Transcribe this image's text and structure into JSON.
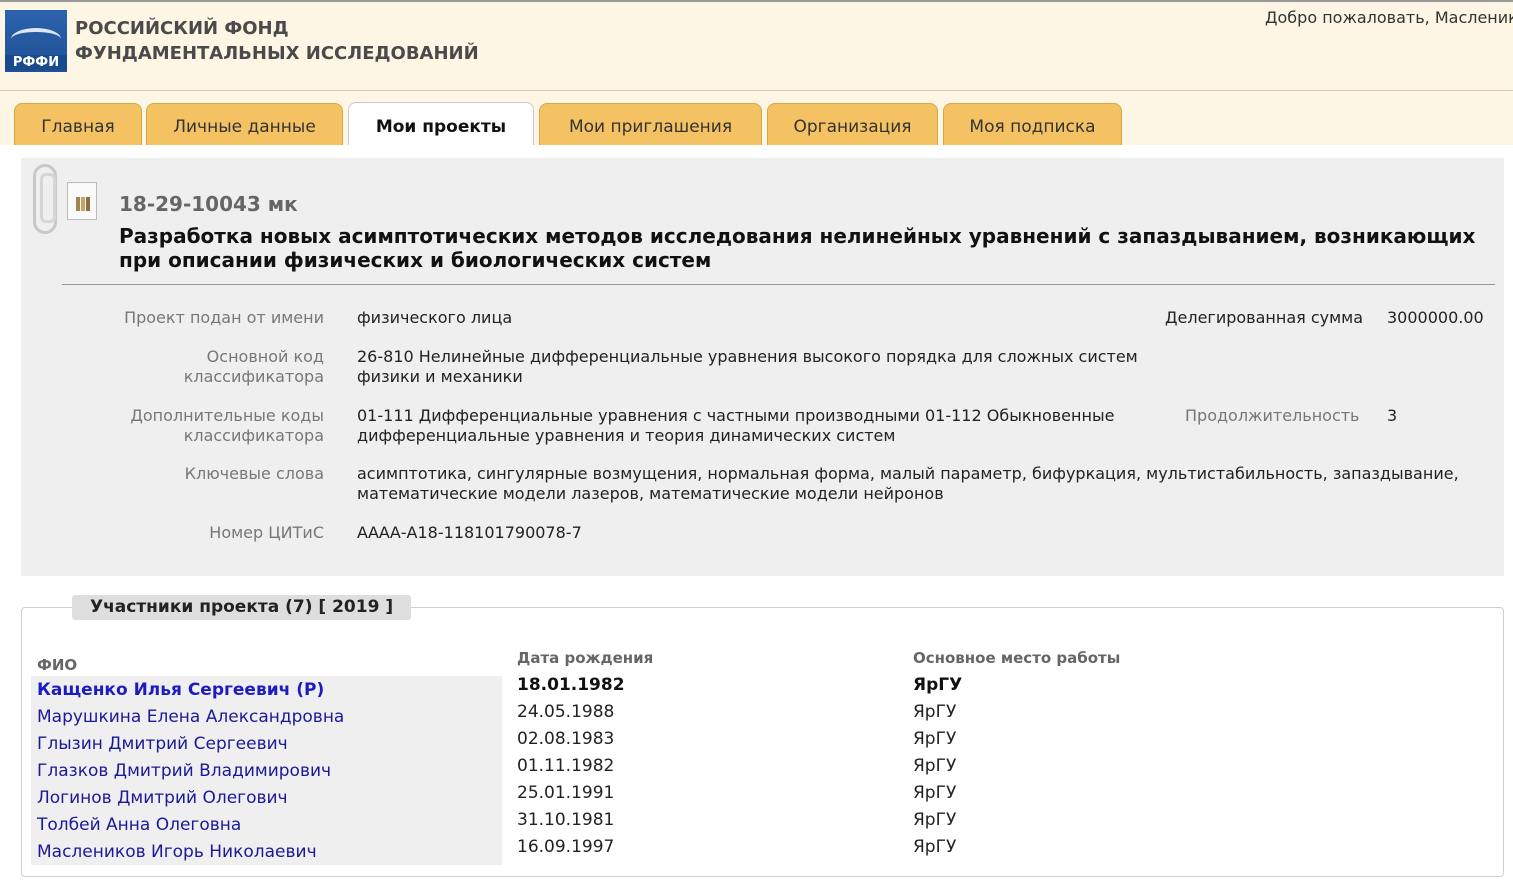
{
  "header": {
    "org_line1": "РОССИЙСКИЙ ФОНД",
    "org_line2": "ФУНДАМЕНТАЛЬНЫХ ИССЛЕДОВАНИЙ",
    "logo_text": "РФФИ",
    "welcome": "Добро пожаловать, Масленик"
  },
  "tabs": [
    {
      "label": "Главная",
      "active": false
    },
    {
      "label": "Личные данные",
      "active": false
    },
    {
      "label": "Мои проекты",
      "active": true
    },
    {
      "label": "Мои приглашения",
      "active": false
    },
    {
      "label": "Организация",
      "active": false
    },
    {
      "label": "Моя подписка",
      "active": false
    }
  ],
  "project": {
    "code": "18-29-10043 мк",
    "title": "Разработка новых асимптотических методов исследования нелинейных уравнений с запаздыванием, возникающих при описании физических и биологических систем",
    "submitted_by_label": "Проект подан от имени",
    "submitted_by_value": "физического лица",
    "delegated_sum_label": "Делегированная сумма",
    "delegated_sum_value": "3000000.00",
    "main_code_label_1": "Основной код",
    "main_code_label_2": "классификатора",
    "main_code_value_1": "26-810 Нелинейные дифференциальные уравнения высокого порядка для сложных систем",
    "main_code_value_2": "физики и механики",
    "extra_codes_label_1": "Дополнительные коды",
    "extra_codes_label_2": "классификатора",
    "extra_codes_value_1": "01-111 Дифференциальные уравнения с частными производными 01-112 Обыкновенные",
    "extra_codes_value_2": "дифференциальные уравнения и теория динамических систем",
    "duration_label": "Продолжительность",
    "duration_value": "3",
    "keywords_label": "Ключевые слова",
    "keywords_value_1": "асимптотика, сингулярные возмущения, нормальная форма, малый параметр, бифуркация, мультистабильность, запаздывание,",
    "keywords_value_2": "математические модели лазеров, математические модели нейронов",
    "citis_label": "Номер ЦИТиС",
    "citis_value": "АААА-А18-118101790078-7"
  },
  "participants": {
    "header": "Участники проекта (7) [ 2019 ]",
    "col_name": "ФИО",
    "col_dob": "Дата рождения",
    "col_work": "Основное место работы",
    "rows": [
      {
        "name": "Кащенко Илья Сергеевич (Р)",
        "dob": "18.01.1982",
        "work": "ЯрГУ",
        "leader": true
      },
      {
        "name": "Марушкина Елена Александровна",
        "dob": "24.05.1988",
        "work": "ЯрГУ",
        "leader": false
      },
      {
        "name": "Глызин Дмитрий Сергеевич",
        "dob": "02.08.1983",
        "work": "ЯрГУ",
        "leader": false
      },
      {
        "name": "Глазков Дмитрий Владимирович",
        "dob": "01.11.1982",
        "work": "ЯрГУ",
        "leader": false
      },
      {
        "name": "Логинов Дмитрий Олегович",
        "dob": "25.01.1991",
        "work": "ЯрГУ",
        "leader": false
      },
      {
        "name": "Толбей Анна Олеговна",
        "dob": "31.10.1981",
        "work": "ЯрГУ",
        "leader": false
      },
      {
        "name": "Маслеников Игорь Николаевич",
        "dob": "16.09.1997",
        "work": "ЯрГУ",
        "leader": false
      }
    ]
  }
}
